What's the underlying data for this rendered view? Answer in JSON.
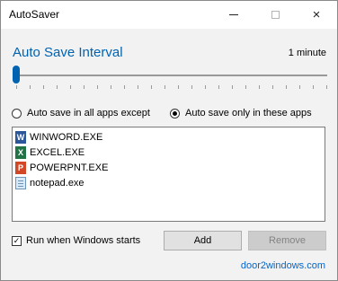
{
  "window": {
    "title": "AutoSaver",
    "controls": {
      "minimize": "minimize",
      "maximize": "maximize",
      "close": "×"
    }
  },
  "interval": {
    "heading": "Auto Save Interval",
    "value_label": "1 minute",
    "slider_level": 0,
    "tick_count": 24
  },
  "mode": {
    "options": [
      {
        "label": "Auto save in all apps except",
        "checked": false
      },
      {
        "label": "Auto save only in these apps",
        "checked": true
      }
    ]
  },
  "apps": [
    {
      "name": "WINWORD.EXE",
      "icon": "word-icon",
      "badge": "W",
      "color": "#2b579a"
    },
    {
      "name": "EXCEL.EXE",
      "icon": "excel-icon",
      "badge": "X",
      "color": "#217346"
    },
    {
      "name": "POWERPNT.EXE",
      "icon": "powerpoint-icon",
      "badge": "P",
      "color": "#d24726"
    },
    {
      "name": "notepad.exe",
      "icon": "notepad-icon",
      "badge": "",
      "color": "#d8eaf7"
    }
  ],
  "footer": {
    "startup_label": "Run when Windows starts",
    "startup_checked": true,
    "add_label": "Add",
    "remove_label": "Remove",
    "remove_enabled": false,
    "link_text": "door2windows.com"
  },
  "colors": {
    "accent": "#0063b1",
    "link": "#0066cc"
  }
}
